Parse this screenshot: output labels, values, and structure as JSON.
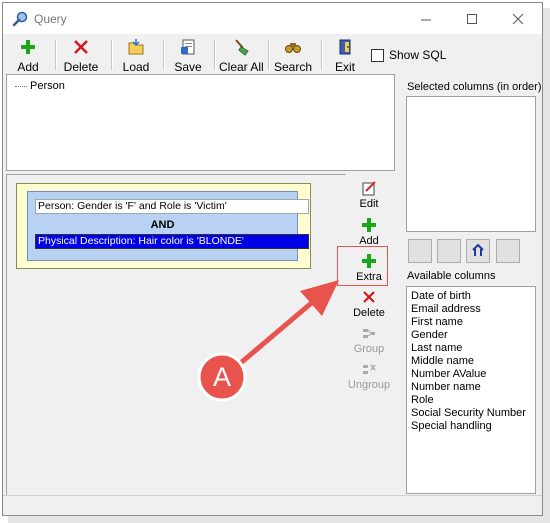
{
  "window": {
    "title": "Query"
  },
  "toolbar": {
    "add": "Add",
    "delete": "Delete",
    "load": "Load",
    "save": "Save",
    "clear_all": "Clear All",
    "search": "Search",
    "exit": "Exit",
    "show_sql": "Show SQL",
    "show_sql_checked": false
  },
  "tree": {
    "root": "Person"
  },
  "conditions": {
    "first": "Person: Gender is 'F' and Role is 'Victim'",
    "operator": "AND",
    "second": "Physical Description: Hair color is 'BLONDE'"
  },
  "side_buttons": {
    "edit": "Edit",
    "add": "Add",
    "extra": "Extra",
    "delete": "Delete",
    "group": "Group",
    "ungroup": "Ungroup"
  },
  "selected_columns": {
    "label": "Selected columns (in order)"
  },
  "available_columns": {
    "label": "Available columns",
    "items": [
      "Date of birth",
      "Email address",
      "First name",
      "Gender",
      "Last name",
      "Middle name",
      "Number AValue",
      "Number name",
      "Role",
      "Social Security Number",
      "Special handling"
    ]
  },
  "annotation": {
    "callout": "A"
  },
  "colors": {
    "selection": "#0000e6",
    "annotation": "#e8534d",
    "condition_box": "#fffdd0"
  }
}
